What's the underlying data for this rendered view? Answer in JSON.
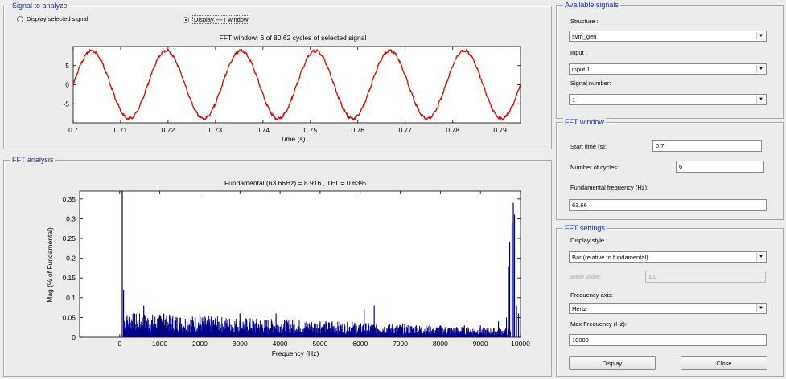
{
  "signal_panel": {
    "title": "Signal to analyze",
    "radio_selected_signal": "Display selected signal",
    "radio_fft_window": "Display FFT window",
    "chart_title": "FFT window: 6 of 80.62 cycles of selected signal",
    "xlabel": "Time (s)",
    "xticks": [
      "0.7",
      "0.71",
      "0.72",
      "0.73",
      "0.74",
      "0.75",
      "0.76",
      "0.77",
      "0.78",
      "0.79"
    ],
    "yticks": [
      "5",
      "0",
      "-5"
    ]
  },
  "fft_panel": {
    "title": "FFT analysis",
    "chart_title": "Fundamental (63.66Hz) = 8.916 , THD= 0.63%",
    "xlabel": "Frequency (Hz)",
    "ylabel": "Mag (% of Fundamental)",
    "xticks": [
      "0",
      "1000",
      "2000",
      "3000",
      "4000",
      "5000",
      "6000",
      "7000",
      "8000",
      "9000",
      "10000"
    ],
    "yticks": [
      "0",
      "0.05",
      "0.1",
      "0.15",
      "0.2",
      "0.25",
      "0.3",
      "0.35"
    ]
  },
  "available_signals": {
    "title": "Available signals",
    "structure_label": "Structure :",
    "structure_value": "svm_gen",
    "input_label": "Input :",
    "input_value": "input 1",
    "signal_number_label": "Signal number:",
    "signal_number_value": "1"
  },
  "fft_window": {
    "title": "FFT window",
    "start_time_label": "Start time (s):",
    "start_time_value": "0.7",
    "cycles_label": "Number of cycles:",
    "cycles_value": "6",
    "fund_freq_label": "Fundamental frequency (Hz):",
    "fund_freq_value": "63.66"
  },
  "fft_settings": {
    "title": "FFT settings",
    "display_style_label": "Display style :",
    "display_style_value": "Bar (relative to fundamental)",
    "base_value_label": "Base value:",
    "base_value_value": "1.0",
    "freq_axis_label": "Frequency axis:",
    "freq_axis_value": "Hertz",
    "max_freq_label": "Max Frequency (Hz):",
    "max_freq_value": "10000",
    "display_button": "Display",
    "close_button": "Close"
  },
  "chart_data": [
    {
      "type": "line",
      "title": "FFT window: 6 of 80.62 cycles of selected signal",
      "xlabel": "Time (s)",
      "ylabel": "",
      "xlim": [
        0.7,
        0.7943
      ],
      "ylim": [
        -10,
        10
      ],
      "series": [
        {
          "amplitude": 8.916,
          "frequency_hz": 63.66,
          "cycles": 6,
          "color": "#e00000"
        }
      ]
    },
    {
      "type": "bar",
      "title": "Fundamental (63.66Hz) = 8.916 , THD= 0.63%",
      "xlabel": "Frequency (Hz)",
      "ylabel": "Mag (% of Fundamental)",
      "xlim": [
        -1000,
        10000
      ],
      "ylim": [
        0,
        0.37
      ],
      "color": "#00008b",
      "x": [
        63.66,
        96,
        160,
        330,
        600,
        1100,
        2000,
        3000,
        3900,
        4350,
        5000,
        5300,
        5800,
        6100,
        6350,
        6700,
        7000,
        7400,
        8000,
        8600,
        9000,
        9450,
        9650,
        9700,
        9730,
        9790,
        9820,
        9850,
        9900,
        9950
      ],
      "values": [
        0.37,
        0.12,
        0.05,
        0.06,
        0.08,
        0.06,
        0.06,
        0.06,
        0.06,
        0.05,
        0.04,
        0.04,
        0.04,
        0.07,
        0.08,
        0.03,
        0.03,
        0.03,
        0.03,
        0.03,
        0.03,
        0.04,
        0.05,
        0.18,
        0.24,
        0.29,
        0.34,
        0.31,
        0.08,
        0.06
      ]
    }
  ]
}
